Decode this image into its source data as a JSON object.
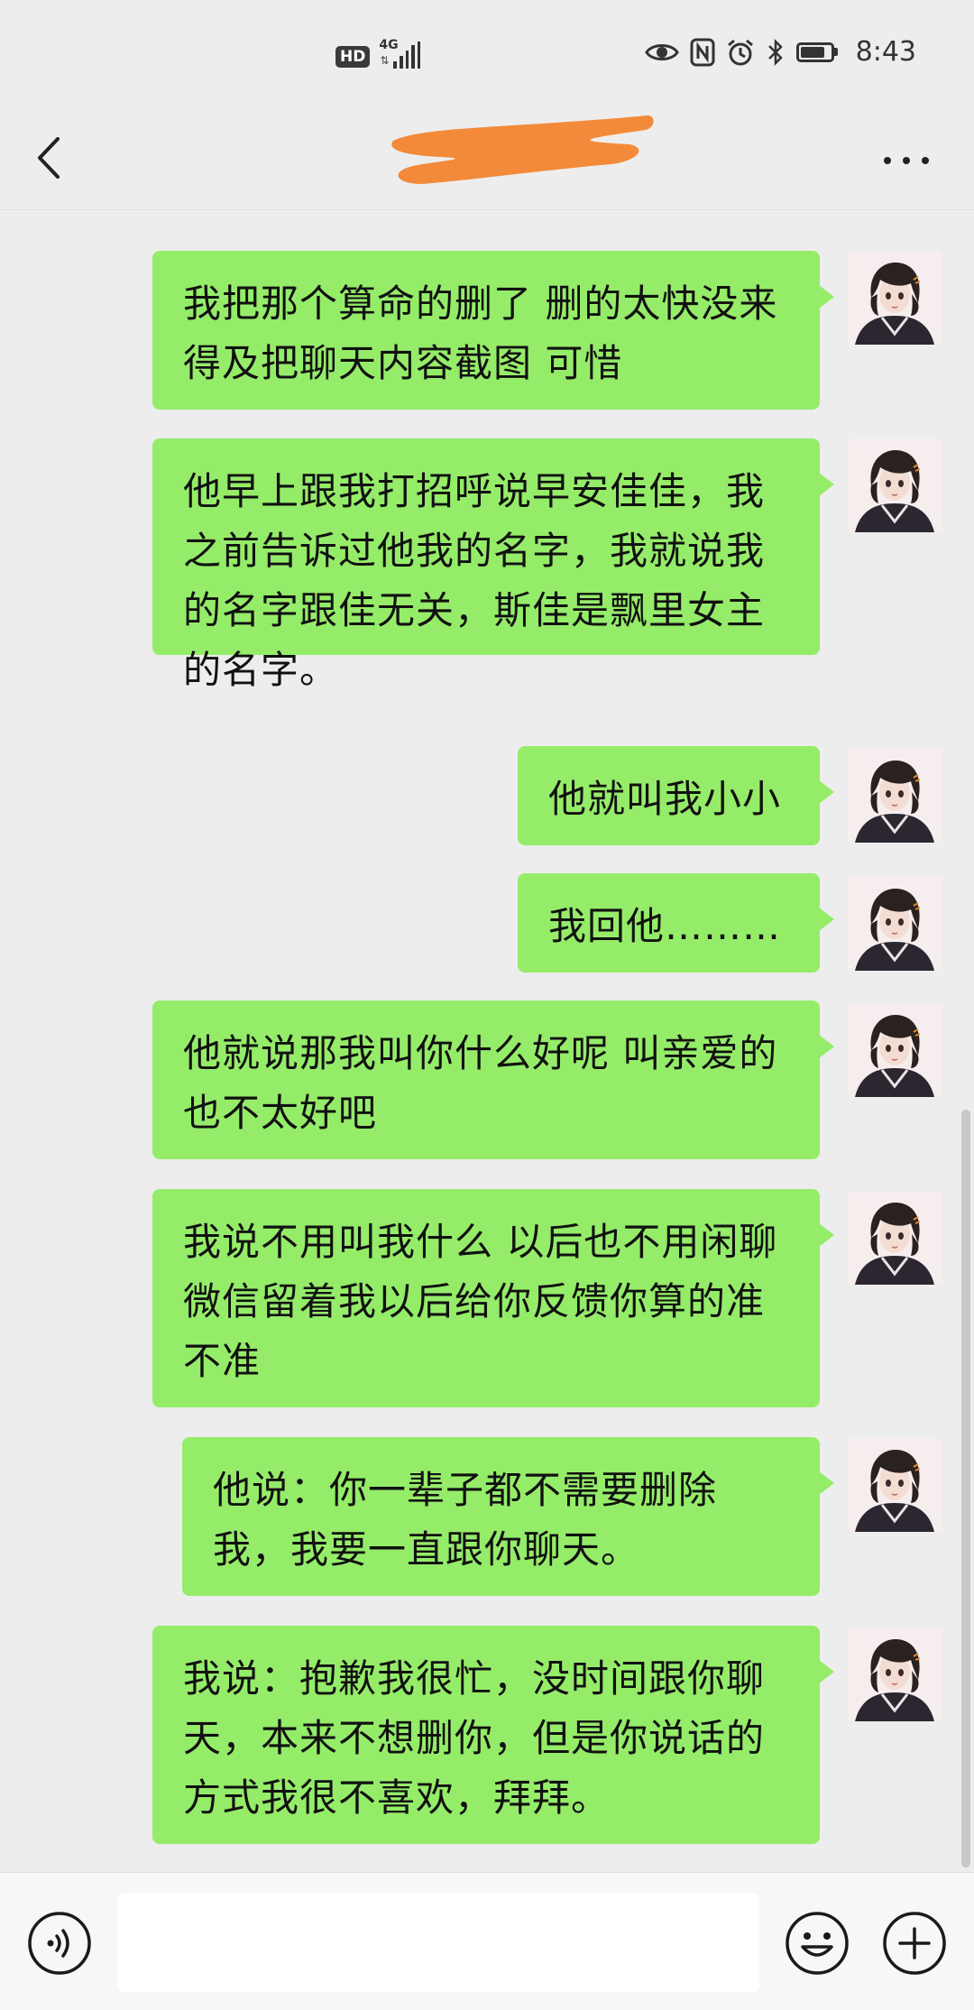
{
  "status_bar": {
    "hd_label": "HD",
    "network_label": "4G",
    "time": "8:43",
    "icons": [
      "eye-icon",
      "nfc-icon",
      "alarm-icon",
      "bluetooth-icon",
      "battery-icon"
    ]
  },
  "header": {
    "contact_name": "",
    "back_icon": "chevron-left-icon",
    "more_icon": "more-dots-icon",
    "name_redaction_color": "#f28a3a"
  },
  "messages": [
    {
      "sender": "me",
      "text": "我把那个算命的删了 删的太快没来得及把聊天内容截图 可惜"
    },
    {
      "sender": "me",
      "text": "他早上跟我打招呼说早安佳佳，我之前告诉过他我的名字，我就说我的名字跟佳无关，斯佳是飘里女主的名字。"
    },
    {
      "sender": "me",
      "text": "他就叫我小小"
    },
    {
      "sender": "me",
      "text": "我回他………"
    },
    {
      "sender": "me",
      "text": "他就说那我叫你什么好呢 叫亲爱的也不太好吧"
    },
    {
      "sender": "me",
      "text": "我说不用叫我什么 以后也不用闲聊 微信留着我以后给你反馈你算的准不准"
    },
    {
      "sender": "me",
      "text": "他说：你一辈子都不需要删除我，我要一直跟你聊天。"
    },
    {
      "sender": "me",
      "text": "我说：抱歉我很忙，没时间跟你聊天，本来不想删你，但是你说话的方式我很不喜欢，拜拜。"
    }
  ],
  "input_bar": {
    "placeholder": "",
    "voice_icon": "voice-icon",
    "emoji_icon": "emoji-icon",
    "plus_icon": "plus-icon"
  },
  "colors": {
    "background": "#ededed",
    "bubble_green": "#95ec69",
    "input_bar": "#f7f7f7"
  }
}
